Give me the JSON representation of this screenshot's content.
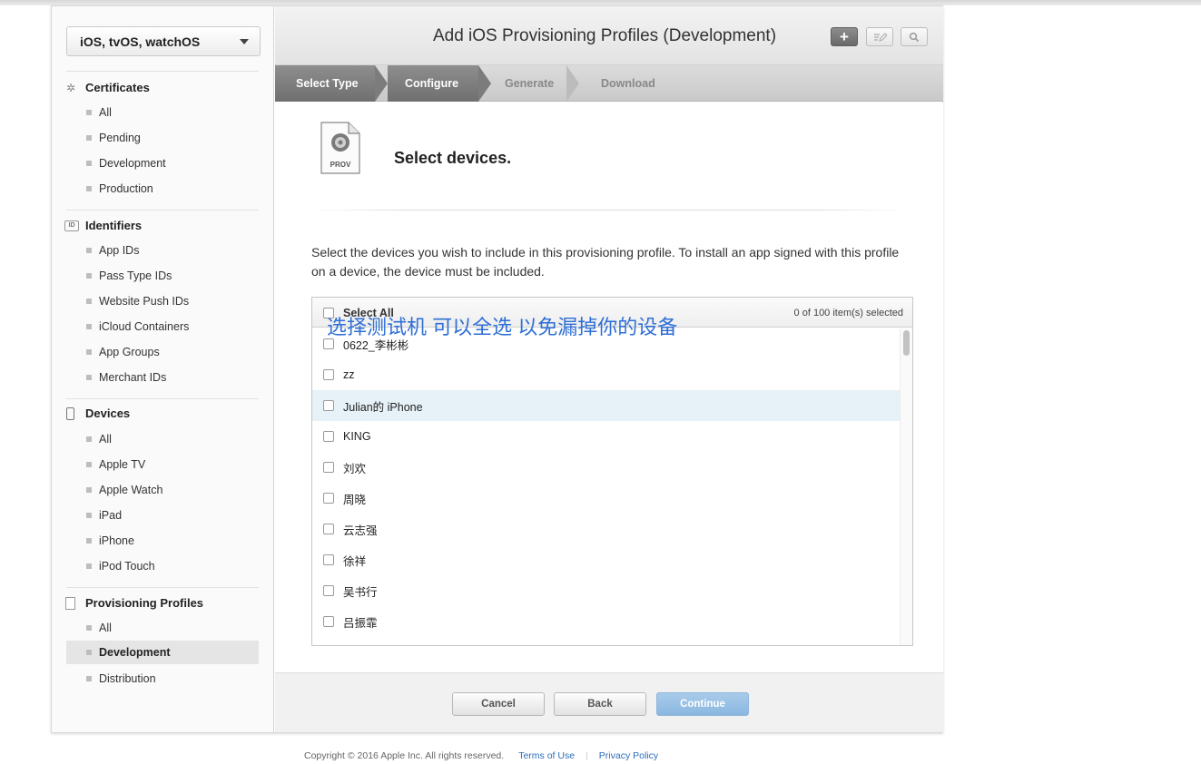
{
  "sidebar": {
    "platform": "iOS, tvOS, watchOS",
    "certificates": {
      "title": "Certificates",
      "items": [
        "All",
        "Pending",
        "Development",
        "Production"
      ]
    },
    "identifiers": {
      "title": "Identifiers",
      "icon_text": "ID",
      "items": [
        "App IDs",
        "Pass Type IDs",
        "Website Push IDs",
        "iCloud Containers",
        "App Groups",
        "Merchant IDs"
      ]
    },
    "devices": {
      "title": "Devices",
      "items": [
        "All",
        "Apple TV",
        "Apple Watch",
        "iPad",
        "iPhone",
        "iPod Touch"
      ]
    },
    "profiles": {
      "title": "Provisioning Profiles",
      "items": [
        "All",
        "Development",
        "Distribution"
      ],
      "active": "Development"
    }
  },
  "header": {
    "title": "Add iOS Provisioning Profiles (Development)",
    "add_label": "+",
    "edit_icon": "edit-icon",
    "search_icon": "search-icon"
  },
  "steps": [
    "Select Type",
    "Configure",
    "Generate",
    "Download"
  ],
  "content": {
    "icon_label": "PROV",
    "heading": "Select devices.",
    "instructions": "Select the devices you wish to include in this provisioning profile. To install an app signed with this profile on a device, the device must be included.",
    "select_all": "Select All",
    "count": "0  of 100 item(s) selected",
    "annotation": "选择测试机  可以全选 以免漏掉你的设备",
    "devices": [
      "0622_李彬彬",
      "zz",
      "Julian的 iPhone",
      "KING",
      "刘欢",
      "周晓",
      "云志强",
      "徐祥",
      "吴书行",
      "吕振霏"
    ]
  },
  "buttons": {
    "cancel": "Cancel",
    "back": "Back",
    "continue": "Continue"
  },
  "footer": {
    "copyright": "Copyright © 2016 Apple Inc. All rights reserved.",
    "terms": "Terms of Use",
    "privacy": "Privacy Policy"
  },
  "colors": {
    "link": "#2a6ebb",
    "annotation": "#2f6fd6",
    "primary_button": "#8ab7e0",
    "hover_row": "#e6f1f8"
  }
}
